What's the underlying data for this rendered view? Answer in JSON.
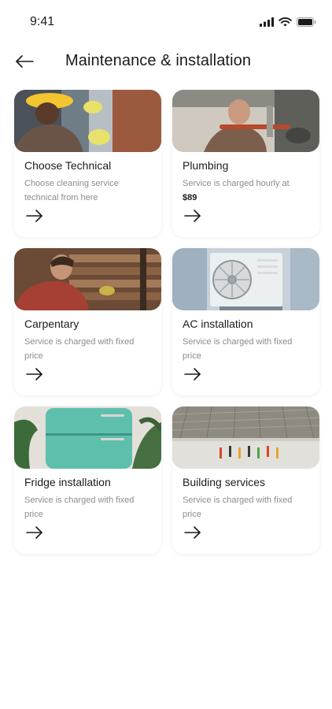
{
  "status_bar": {
    "time": "9:41"
  },
  "header": {
    "title": "Maintenance & installation",
    "back_icon": "arrow-left-icon"
  },
  "services": [
    {
      "title": "Choose Technical",
      "description": "Choose cleaning service technical from here",
      "price": "",
      "image": "technician-photo"
    },
    {
      "title": "Plumbing",
      "description": "Service is charged hourly at",
      "price": "$89",
      "image": "plumber-photo"
    },
    {
      "title": "Carpentary",
      "description": "Service is charged with fixed price",
      "price": "",
      "image": "carpenter-photo"
    },
    {
      "title": "AC installation",
      "description": "Service is charged with fixed price",
      "price": "",
      "image": "ac-unit-photo"
    },
    {
      "title": "Fridge installation",
      "description": "Service is charged with fixed price",
      "price": "",
      "image": "fridge-photo"
    },
    {
      "title": "Building services",
      "description": "Service is charged with fixed price",
      "price": "",
      "image": "construction-site-photo"
    }
  ],
  "arrow_icon": "arrow-right-icon",
  "colors": {
    "text": "#1b1b1b",
    "muted": "#8c8c8c",
    "background": "#ffffff"
  }
}
